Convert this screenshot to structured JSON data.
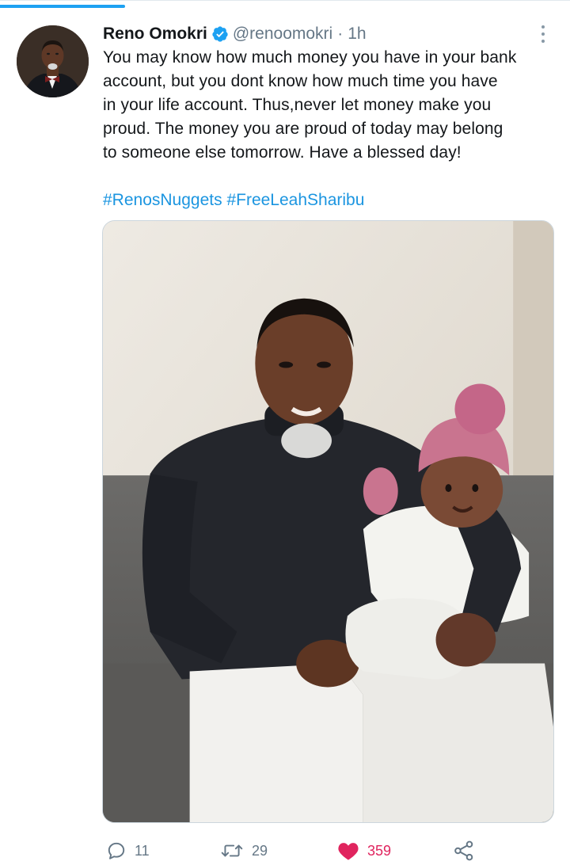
{
  "tweet": {
    "author": {
      "display_name": "Reno Omokri",
      "verified": true,
      "handle": "@renoomokri",
      "separator": "·",
      "timestamp": "1h"
    },
    "text_lines": [
      "You may know how much money you have in your bank",
      "account, but you dont know how much time you have",
      "in your life account. Thus,never let money make you",
      "proud. The money you are proud of today may belong",
      "to someone else tomorrow. Have a blessed day!"
    ],
    "hashtags": [
      "#RenosNuggets",
      "#FreeLeahSharibu"
    ],
    "actions": {
      "reply_count": "11",
      "retweet_count": "29",
      "like_count": "359",
      "liked": true
    }
  },
  "icons": {
    "verified": "verified-badge-icon",
    "more": "more-vertical-icon",
    "reply": "reply-icon",
    "retweet": "retweet-icon",
    "like": "heart-icon",
    "share": "share-icon"
  },
  "colors": {
    "accent": "#1da1f2",
    "link": "#1b95e0",
    "like": "#e0245e",
    "secondary_text": "#657786"
  }
}
